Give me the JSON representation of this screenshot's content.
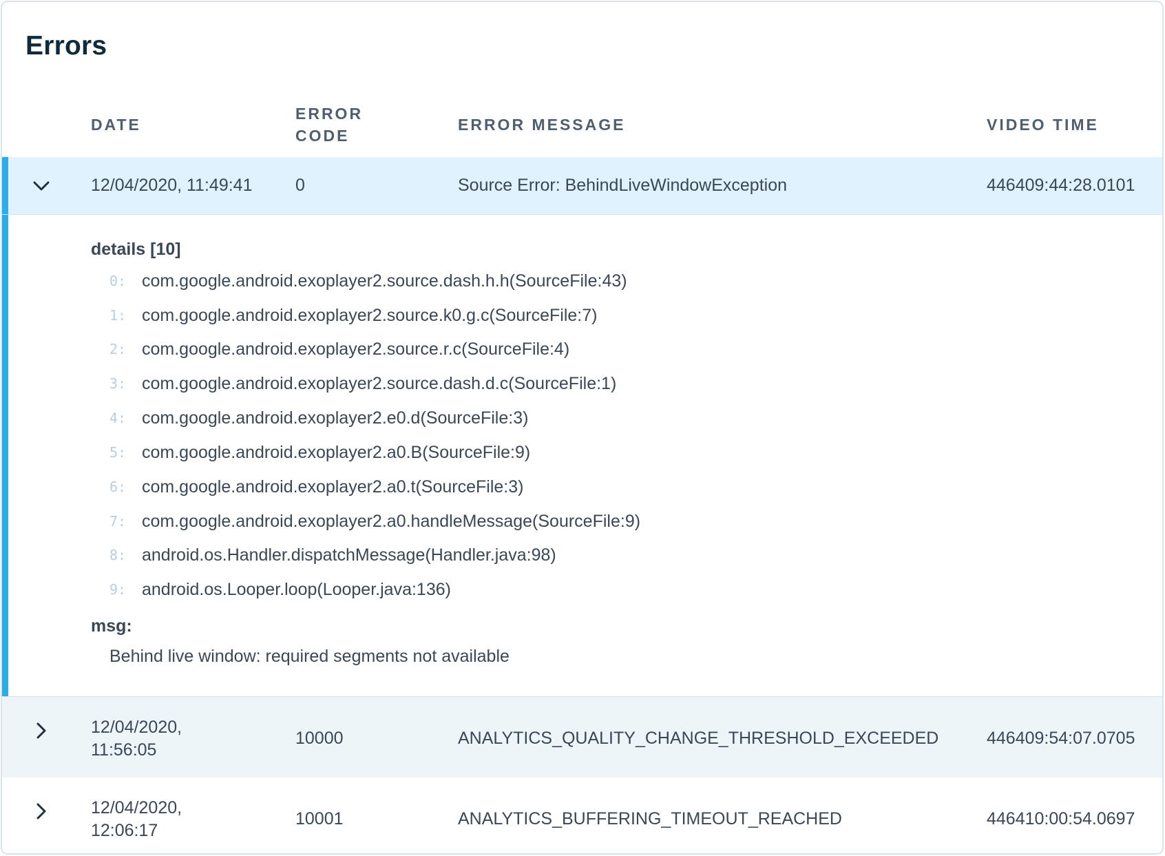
{
  "panel": {
    "title": "Errors"
  },
  "columns": {
    "date": "DATE",
    "error_code": "ERROR CODE",
    "error_message": "ERROR MESSAGE",
    "video_time": "VIDEO TIME"
  },
  "rows": [
    {
      "date_line1": "12/04/2020, 11:49:41",
      "date_line2": "",
      "code": "0",
      "message": "Source Error: BehindLiveWindowException",
      "video_time": "446409:44:28.0101",
      "expanded": true,
      "toggle_icon": "chevron-down-icon"
    },
    {
      "date_line1": "12/04/2020,",
      "date_line2": "11:56:05",
      "code": "10000",
      "message": "ANALYTICS_QUALITY_CHANGE_THRESHOLD_EXCEEDED",
      "video_time": "446409:54:07.0705",
      "expanded": false,
      "toggle_icon": "chevron-right-icon"
    },
    {
      "date_line1": "12/04/2020,",
      "date_line2": "12:06:17",
      "code": "10001",
      "message": "ANALYTICS_BUFFERING_TIMEOUT_REACHED",
      "video_time": "446410:00:54.0697",
      "expanded": false,
      "toggle_icon": "chevron-right-icon"
    }
  ],
  "details": {
    "details_label": "details [10]",
    "lines": [
      {
        "index": "0:",
        "text": "com.google.android.exoplayer2.source.dash.h.h(SourceFile:43)"
      },
      {
        "index": "1:",
        "text": "com.google.android.exoplayer2.source.k0.g.c(SourceFile:7)"
      },
      {
        "index": "2:",
        "text": "com.google.android.exoplayer2.source.r.c(SourceFile:4)"
      },
      {
        "index": "3:",
        "text": "com.google.android.exoplayer2.source.dash.d.c(SourceFile:1)"
      },
      {
        "index": "4:",
        "text": "com.google.android.exoplayer2.e0.d(SourceFile:3)"
      },
      {
        "index": "5:",
        "text": "com.google.android.exoplayer2.a0.B(SourceFile:9)"
      },
      {
        "index": "6:",
        "text": "com.google.android.exoplayer2.a0.t(SourceFile:3)"
      },
      {
        "index": "7:",
        "text": "com.google.android.exoplayer2.a0.handleMessage(SourceFile:9)"
      },
      {
        "index": "8:",
        "text": "android.os.Handler.dispatchMessage(Handler.java:98)"
      },
      {
        "index": "9:",
        "text": "android.os.Looper.loop(Looper.java:136)"
      }
    ],
    "msg_label": "msg:",
    "msg_text": "Behind live window: required segments not available"
  },
  "colors": {
    "accent": "#29aeea",
    "selected_row_bg": "#dff2fd",
    "striped_row_bg": "#edf5f9",
    "title": "#0e2a3b",
    "index_muted": "#b9cede"
  }
}
